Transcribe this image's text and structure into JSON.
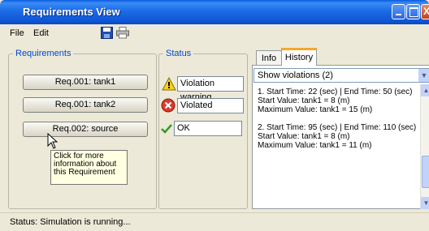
{
  "window": {
    "title": "Requirements View",
    "controls": {
      "minimize": "",
      "maximize": "",
      "close": "X"
    }
  },
  "menu": {
    "file": "File",
    "edit": "Edit"
  },
  "toolbar": {
    "save_icon": "floppy-disk-icon",
    "print_icon": "printer-icon"
  },
  "requirements": {
    "legend": "Requirements",
    "buttons": [
      "Req.001: tank1",
      "Req.001: tank2",
      "Req.002: source"
    ],
    "tooltip": [
      "Click for more",
      "information about",
      "this Requirement"
    ]
  },
  "status_panel": {
    "legend": "Status",
    "items": [
      {
        "label": "Violation warning",
        "icon": "warning-icon"
      },
      {
        "label": "Violated",
        "icon": "error-icon"
      },
      {
        "label": "OK",
        "icon": "checkmark-icon"
      }
    ]
  },
  "tabs": {
    "info": "Info",
    "history": "History"
  },
  "history": {
    "dropdown_value": "Show violations (2)",
    "violations": [
      [
        "1. Start Time: 22 (sec) | End Time: 50 (sec)",
        "Start Value: tank1 = 8 (m)",
        "Maximum Value: tank1 = 15 (m)"
      ],
      [
        "2. Start Time: 95 (sec) | End Time: 110 (sec)",
        "Start Value: tank1 = 8 (m)",
        "Maximum Value: tank1 = 11 (m)"
      ]
    ]
  },
  "statusbar": {
    "text": "Status: Simulation is running..."
  },
  "colors": {
    "title_bar": "#0f56d6",
    "legend_text": "#0046d5",
    "history_tab_accent": "#f4a82a",
    "tooltip_bg": "#ffffe1"
  }
}
